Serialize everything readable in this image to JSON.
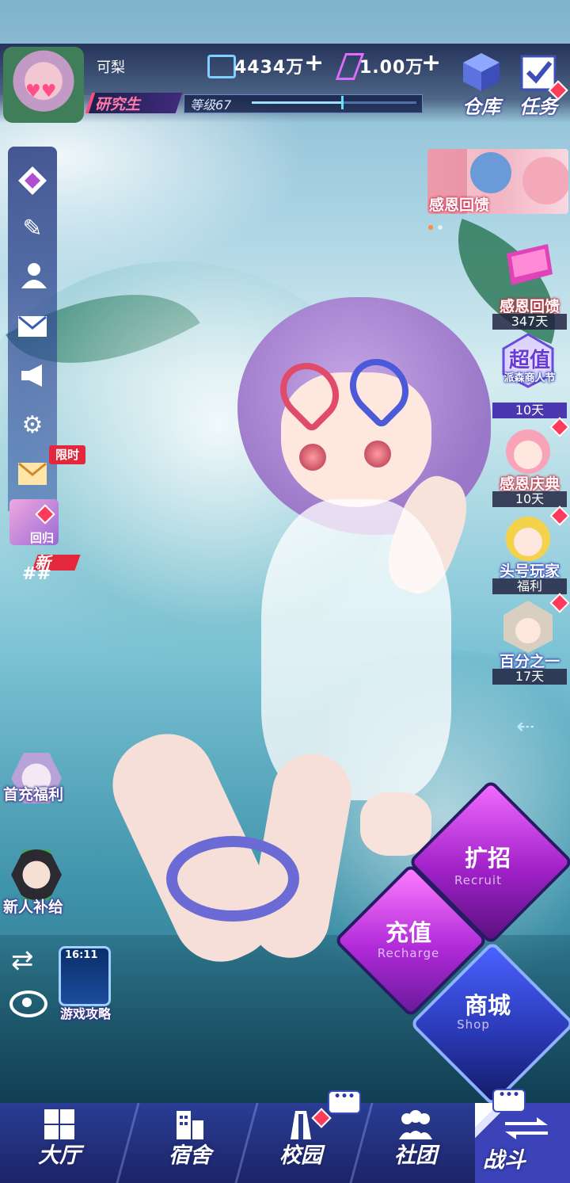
{
  "colors": {
    "accent_red": "#e3273c",
    "accent_purple": "#9b3cf0",
    "nav_blue": "#2a3d94",
    "title_pink": "#ff7aa6"
  },
  "player": {
    "name": "可梨",
    "title": "研究生",
    "level_label": "等级67",
    "xp_progress": 0.55
  },
  "currency": {
    "gold": "4434万",
    "gems": "1.00万"
  },
  "top_buttons": {
    "warehouse": "仓库",
    "tasks": "任务"
  },
  "sidebar": {
    "limited_tag": "限时",
    "back_label": "回归",
    "new_tag": "新",
    "hash": "##"
  },
  "left_badges": {
    "first_recharge": "首充福利",
    "newbie_supply": "新人补给",
    "game_guide": "游戏攻略",
    "phone_time": "16:11"
  },
  "event_banner": {
    "label": "感恩回馈"
  },
  "events": [
    {
      "name": "感恩回馈",
      "days": "347天"
    },
    {
      "name": "超值",
      "sub": "派森商人节",
      "days": "10天"
    },
    {
      "name": "感恩庆典",
      "days": "10天"
    },
    {
      "name": "头号玩家",
      "days": "福利"
    },
    {
      "name": "百分之一",
      "days": "17天"
    }
  ],
  "actions": {
    "recruit": {
      "label": "扩招",
      "sub": "Recruit"
    },
    "recharge": {
      "label": "充值",
      "sub": "Recharge"
    },
    "shop": {
      "label": "商城",
      "sub": "Shop"
    }
  },
  "nav": {
    "hall": "大厅",
    "dorm": "宿舍",
    "campus": "校园",
    "club": "社团",
    "battle": "战斗"
  }
}
